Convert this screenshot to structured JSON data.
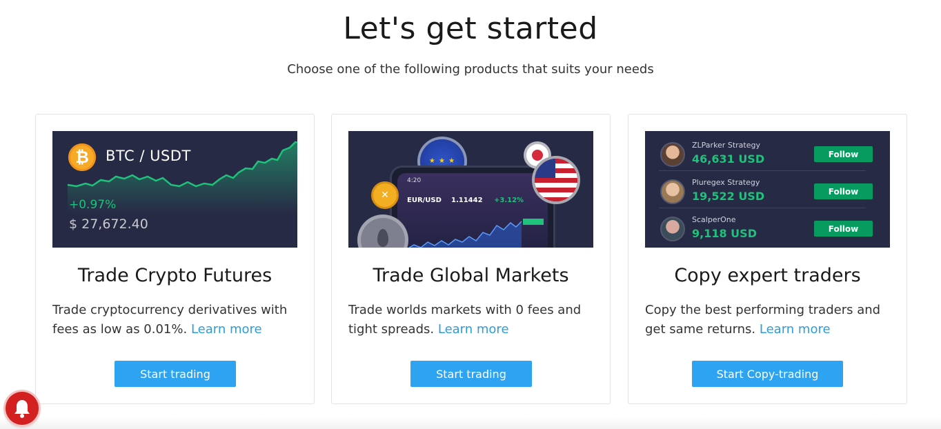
{
  "header": {
    "title": "Let's get started",
    "subtitle": "Choose one of the following products that suits your needs"
  },
  "cards": [
    {
      "title": "Trade Crypto Futures",
      "description": "Trade cryptocurrency derivatives with fees as low as 0.01%.",
      "learn_more": "Learn more",
      "cta": "Start trading",
      "banner": {
        "pair": "BTC / USDT",
        "coin_icon": "bitcoin-icon",
        "change": "+0.97%",
        "price": "$ 27,672.40"
      }
    },
    {
      "title": "Trade Global Markets",
      "description": "Trade worlds markets with 0 fees and tight spreads.",
      "learn_more": "Learn more",
      "cta": "Start trading",
      "banner": {
        "time": "4:20",
        "pair": "EUR/USD",
        "price": "1.11442",
        "change": "+3.12%"
      }
    },
    {
      "title": "Copy expert traders",
      "description": "Copy the best performing traders and get same returns.",
      "learn_more": "Learn more",
      "cta": "Start Copy-trading",
      "banner": {
        "traders": [
          {
            "name": "ZLParker Strategy",
            "amount": "46,631 USD",
            "follow": "Follow"
          },
          {
            "name": "Pluregex Strategy",
            "amount": "19,522 USD",
            "follow": "Follow"
          },
          {
            "name": "ScalperOne",
            "amount": "9,118 USD",
            "follow": "Follow"
          }
        ]
      }
    }
  ],
  "colors": {
    "accent": "#2ea3f2",
    "banner_bg": "#272a45",
    "positive": "#1fc27a",
    "follow": "#089b5f",
    "link": "#2d9cdb"
  },
  "notification": {
    "icon": "bell-icon"
  }
}
